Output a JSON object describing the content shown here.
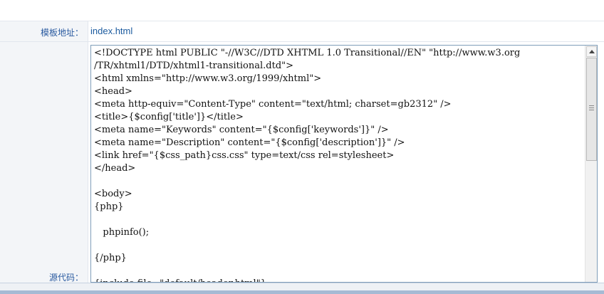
{
  "template_row": {
    "label": "模板地址：",
    "value": "index.html"
  },
  "source_row": {
    "label": "源代码：",
    "code": "<!DOCTYPE html PUBLIC \"-//W3C//DTD XHTML 1.0 Transitional//EN\" \"http://www.w3.org\n/TR/xhtml1/DTD/xhtml1-transitional.dtd\">\n<html xmlns=\"http://www.w3.org/1999/xhtml\">\n<head>\n<meta http-equiv=\"Content-Type\" content=\"text/html; charset=gb2312\" />\n<title>{$config['title']}</title>\n<meta name=\"Keywords\" content=\"{$config['keywords']}\" />\n<meta name=\"Description\" content=\"{$config['description']}\" />\n<link href=\"{$css_path}css.css\" type=text/css rel=stylesheet>\n</head>\n\n<body>\n{php}\n\n   phpinfo();\n\n{/php}\n\n{include file=\"default/header.html\"}"
  }
}
